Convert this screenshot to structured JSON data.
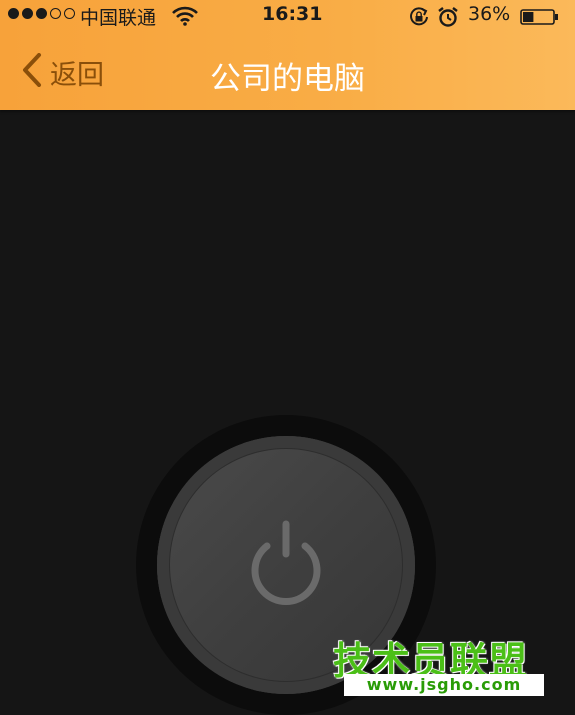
{
  "status_bar": {
    "signal": {
      "filled": 3,
      "total": 5
    },
    "carrier": "中国联通",
    "time": "16:31",
    "battery_percent": "36%",
    "battery_level": 0.36,
    "icons": [
      "wifi-icon",
      "rotation-lock-icon",
      "alarm-icon",
      "battery-icon"
    ]
  },
  "nav": {
    "back_label": "返回",
    "title": "公司的电脑",
    "accent_color": "#f9ad46"
  },
  "power": {
    "icon": "power-icon"
  },
  "watermark": {
    "title": "技术员联盟",
    "url": "www.jsgho.com"
  }
}
